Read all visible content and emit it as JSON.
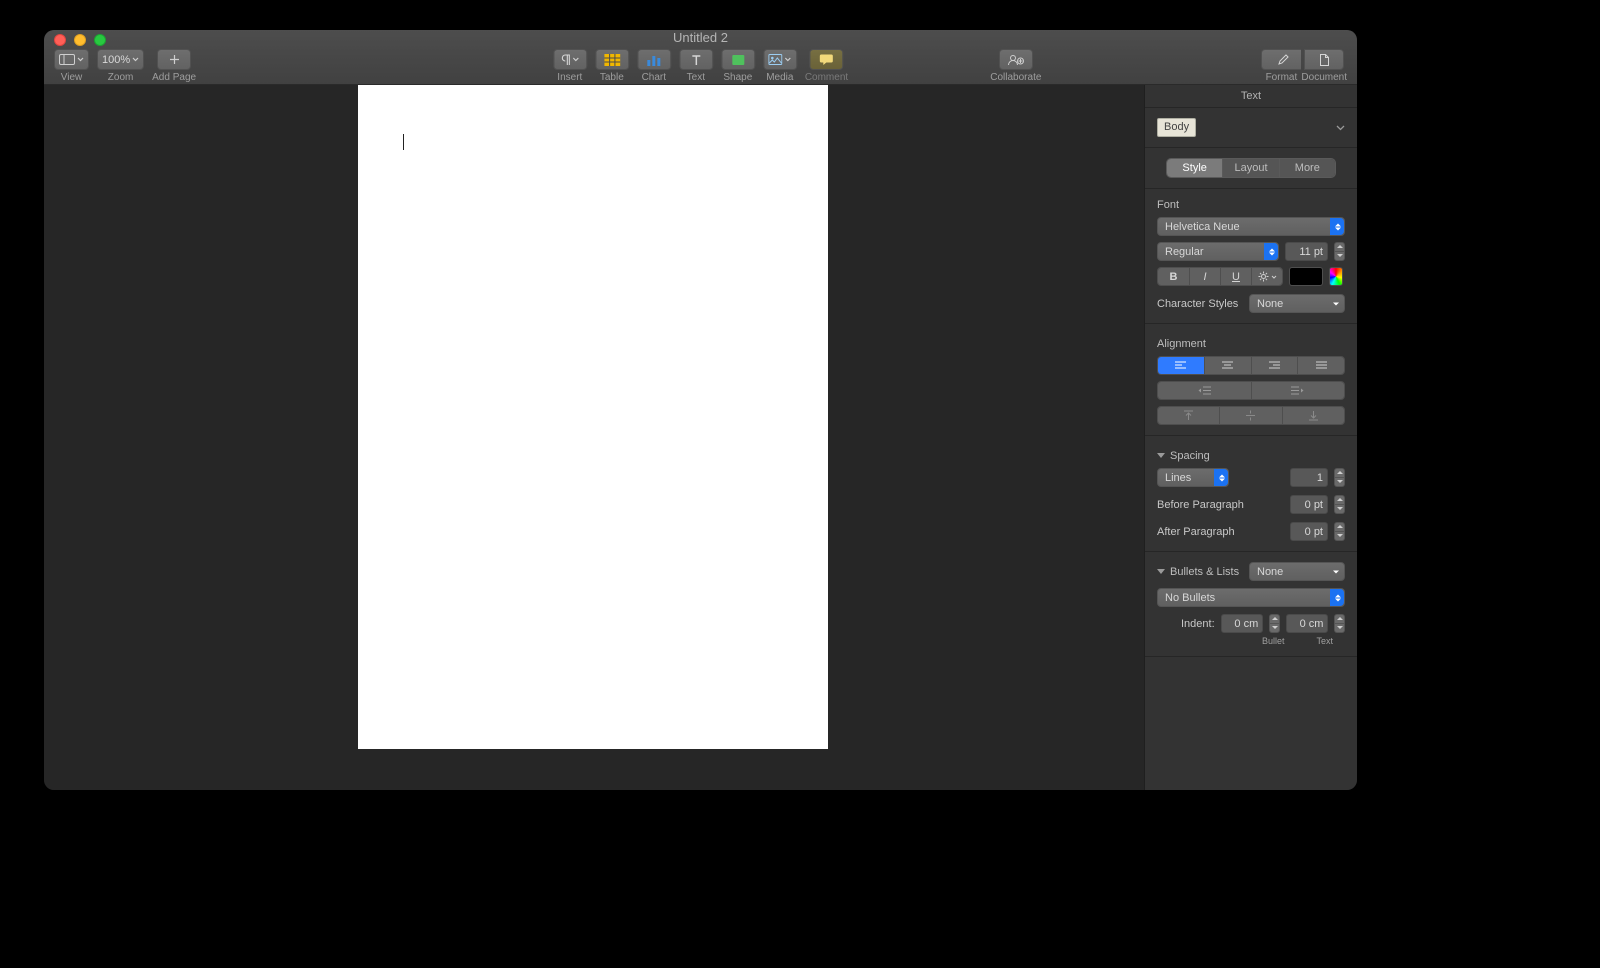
{
  "window": {
    "title": "Untitled 2"
  },
  "toolbar": {
    "left": {
      "view_label": "View",
      "zoom_level": "100%",
      "zoom_label": "Zoom",
      "add_page_label": "Add Page"
    },
    "center": {
      "insert_label": "Insert",
      "table_label": "Table",
      "chart_label": "Chart",
      "text_label": "Text",
      "shape_label": "Shape",
      "media_label": "Media",
      "comment_label": "Comment"
    },
    "right": {
      "collaborate_label": "Collaborate",
      "format_label": "Format",
      "document_label": "Document"
    }
  },
  "inspector": {
    "tab_label": "Text",
    "paragraph_style": "Body",
    "segments": {
      "style": "Style",
      "layout": "Layout",
      "more": "More"
    },
    "font": {
      "section_label": "Font",
      "family": "Helvetica Neue",
      "style": "Regular",
      "size": "11 pt",
      "bold": "B",
      "italic": "I",
      "underline": "U",
      "char_styles_label": "Character Styles",
      "char_style": "None"
    },
    "alignment": {
      "section_label": "Alignment"
    },
    "spacing": {
      "section_label": "Spacing",
      "mode": "Lines",
      "value": "1",
      "before_label": "Before Paragraph",
      "before": "0 pt",
      "after_label": "After Paragraph",
      "after": "0 pt"
    },
    "bullets": {
      "section_label": "Bullets & Lists",
      "list_style": "None",
      "bullets_style": "No Bullets",
      "indent_label": "Indent:",
      "indent_bullet": "0 cm",
      "indent_text": "0 cm",
      "bullet_label": "Bullet",
      "text_label": "Text"
    }
  }
}
